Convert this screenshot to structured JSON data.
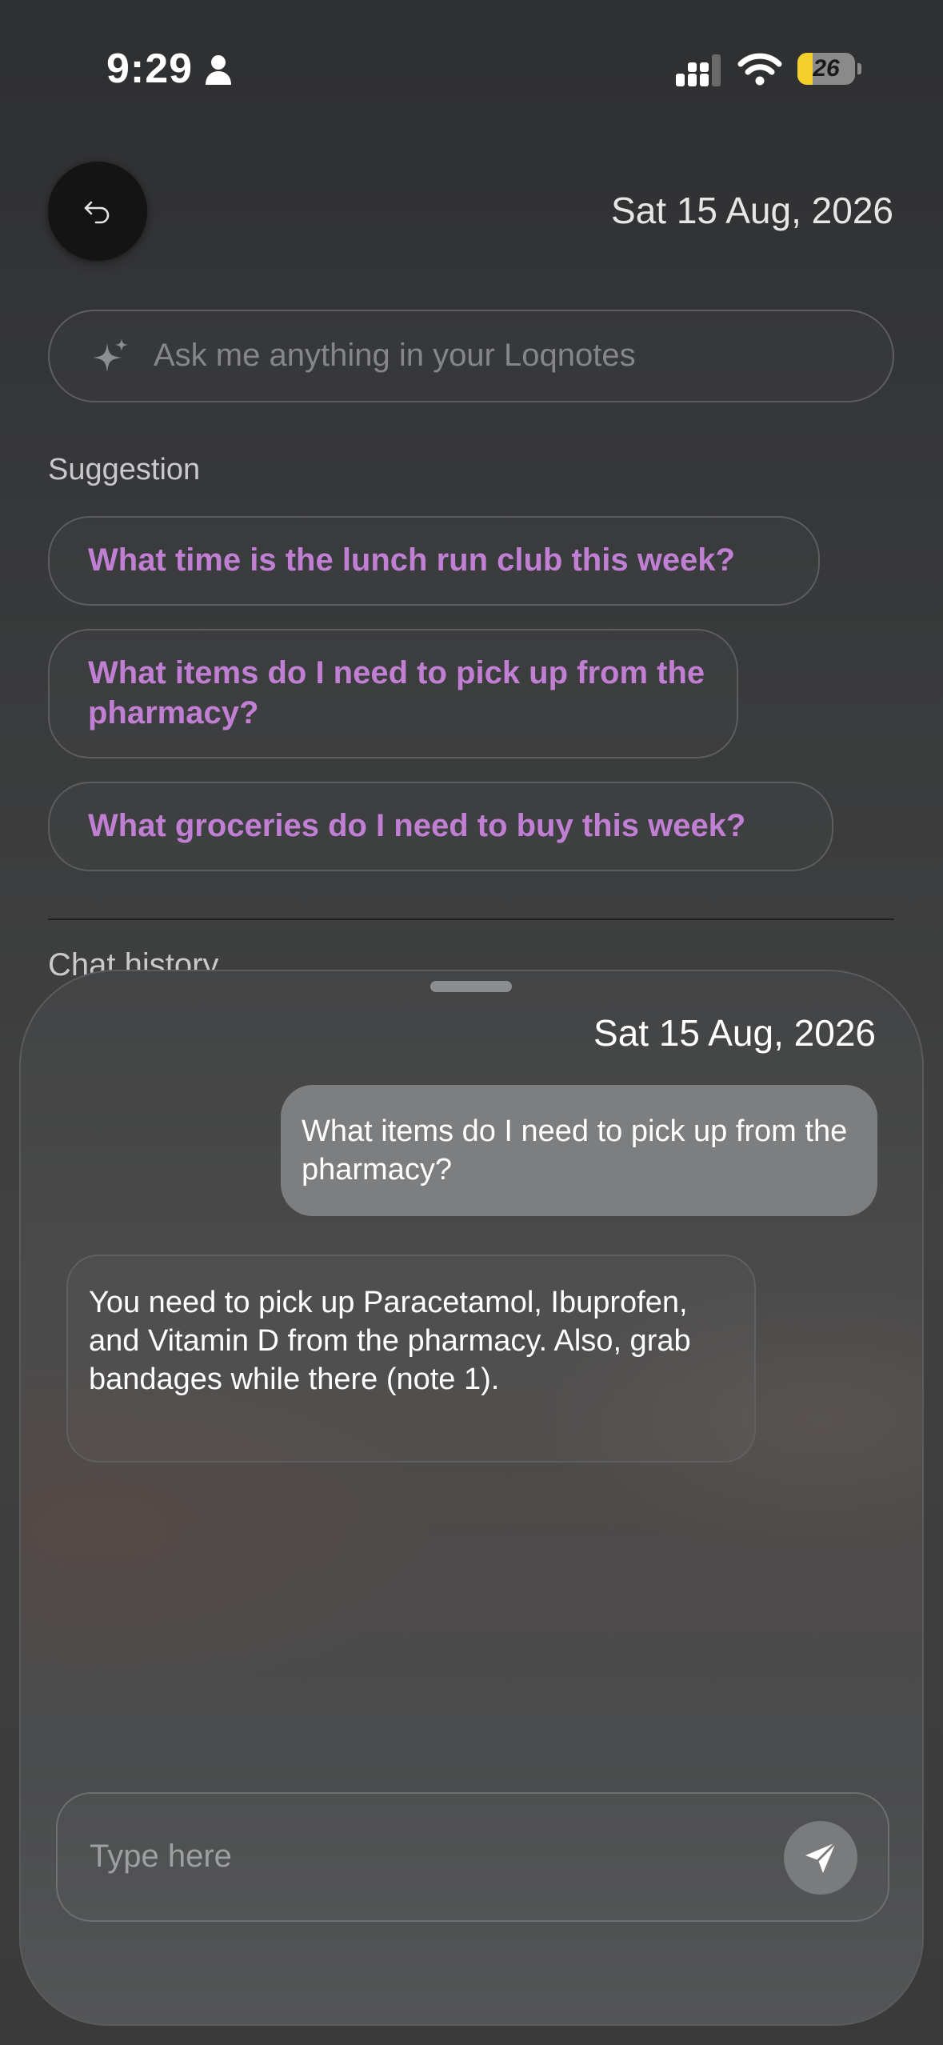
{
  "status_bar": {
    "time": "9:29",
    "battery_level": "26",
    "battery_percent": 26,
    "battery_color": "#f4d02b"
  },
  "header": {
    "back_icon": "undo-arrow-icon",
    "date": "Sat 15 Aug, 2026"
  },
  "search": {
    "icon": "sparkle-icon",
    "placeholder": "Ask me anything in your Loqnotes"
  },
  "suggestions": {
    "heading": "Suggestion",
    "accent_color": "#c17fd4",
    "items": [
      "What time is the lunch run club this week?",
      "What items do I need to pick up from the pharmacy?",
      "What groceries do I need to buy this week?"
    ]
  },
  "chat_history": {
    "heading": "Chat history"
  },
  "sheet": {
    "date": "Sat 15 Aug, 2026",
    "messages": [
      {
        "role": "user",
        "text": "What items do I need to pick up from the pharmacy?"
      },
      {
        "role": "assistant",
        "text": "You need to pick up Paracetamol, Ibuprofen, and Vitamin D from the pharmacy. Also, grab bandages while there (note 1)."
      }
    ],
    "input": {
      "placeholder": "Type here",
      "send_icon": "send-paper-plane-icon"
    }
  }
}
